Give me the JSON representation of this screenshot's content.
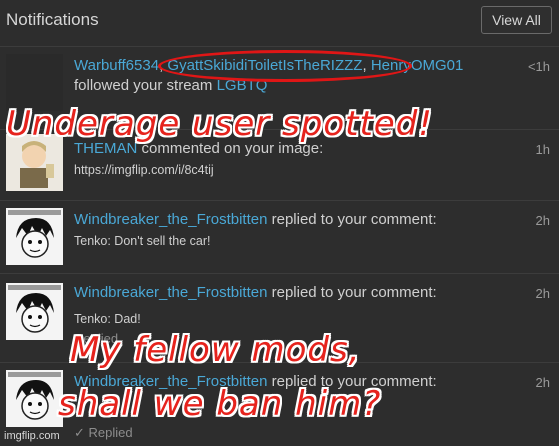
{
  "header": {
    "title": "Notifications",
    "view_all": "View All"
  },
  "notifications": [
    {
      "user_a": "Warbuff6534",
      "user_b": "GyattSkibidiToiletIsTheRIZZZ",
      "user_c": "HenryOMG01",
      "text": "followed your stream",
      "stream": "LGBTQ",
      "time": "<1h"
    },
    {
      "user": "THEMAN",
      "text": "commented on your image:",
      "detail": "https://imgflip.com/i/8c4tij",
      "time": "1h"
    },
    {
      "user": "Windbreaker_the_Frostbitten",
      "text": "replied to your comment:",
      "detail": "Tenko: Don't sell the car!",
      "time": "2h"
    },
    {
      "user": "Windbreaker_the_Frostbitten",
      "text": "replied to your comment:",
      "detail": "Tenko: Dad!",
      "status": "Replied",
      "time": "2h"
    },
    {
      "user": "Windbreaker_the_Frostbitten",
      "text": "replied to your comment:",
      "status": "✓ Replied",
      "time": "2h"
    }
  ],
  "captions": {
    "top": "Underage user spotted!",
    "bottom_line1": "My fellow mods,",
    "bottom_line2": "shall we ban him?"
  },
  "watermark": "imgflip.com",
  "colors": {
    "background": "#2d2d2d",
    "username": "#4aa8d6",
    "caption": "#e6231d",
    "highlight_ring": "#e01616"
  }
}
